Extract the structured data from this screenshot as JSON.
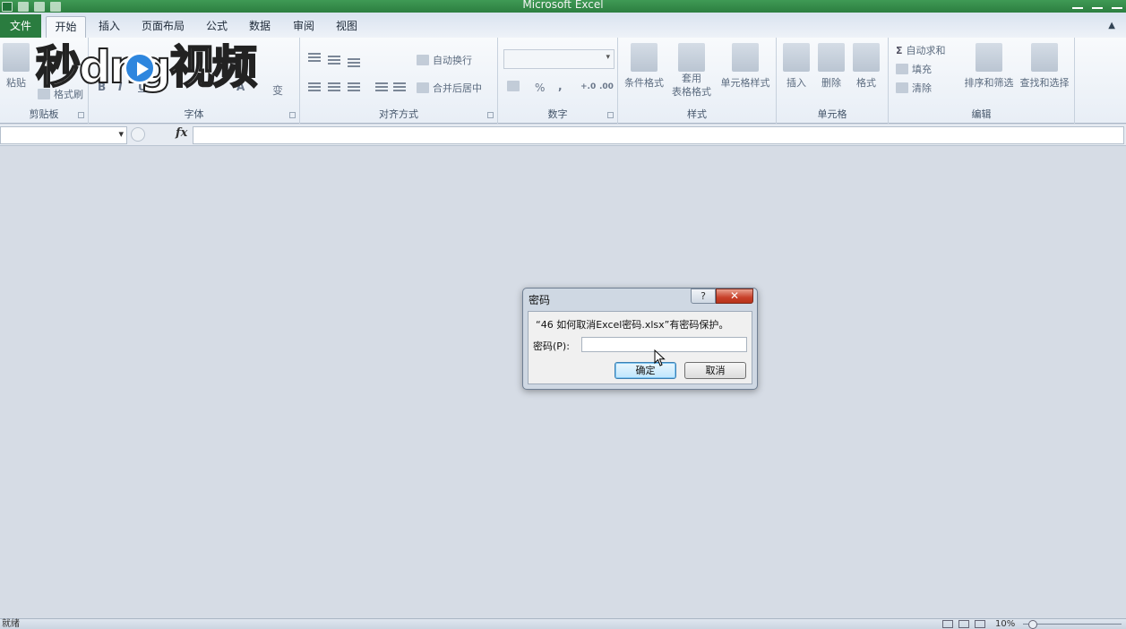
{
  "window": {
    "title": "Microsoft Excel"
  },
  "tabs": [
    {
      "label": "文件"
    },
    {
      "label": "开始"
    },
    {
      "label": "插入"
    },
    {
      "label": "页面布局"
    },
    {
      "label": "公式"
    },
    {
      "label": "数据"
    },
    {
      "label": "审阅"
    },
    {
      "label": "视图"
    }
  ],
  "ribbon": {
    "clipboard": {
      "label": "剪贴板",
      "paste": "粘贴",
      "format_painter": "格式刷"
    },
    "font": {
      "label": "字体",
      "bold": "B",
      "italic": "I",
      "underline": "U",
      "font_color": "A",
      "phonetic": "变"
    },
    "alignment": {
      "label": "对齐方式",
      "wrap_text": "自动换行",
      "merge_center": "合并后居中"
    },
    "number": {
      "label": "数字",
      "percent": "%",
      "comma": ",",
      "inc_decimal": "+.0",
      "dec_decimal": ".00"
    },
    "styles": {
      "label": "样式",
      "conditional": "条件格式",
      "table_format_line1": "套用",
      "table_format_line2": "表格格式",
      "cell_styles": "单元格样式"
    },
    "cells": {
      "label": "单元格",
      "insert": "插入",
      "delete": "删除",
      "format": "格式"
    },
    "editing": {
      "label": "编辑",
      "autosum": "自动求和",
      "fill": "填充",
      "clear": "清除",
      "sort_filter": "排序和筛选",
      "find_select": "查找和选择"
    }
  },
  "watermark": {
    "text": "秒dng视频"
  },
  "formula_bar": {
    "fx": "fx"
  },
  "dialog": {
    "title": "密码",
    "help": "?",
    "close": "✕",
    "message": "“46 如何取消Excel密码.xlsx”有密码保护。",
    "password_label": "密码(P):",
    "password_value": "",
    "ok": "确定",
    "cancel": "取消"
  },
  "status_bar": {
    "status": "就绪",
    "zoom": "10%"
  }
}
